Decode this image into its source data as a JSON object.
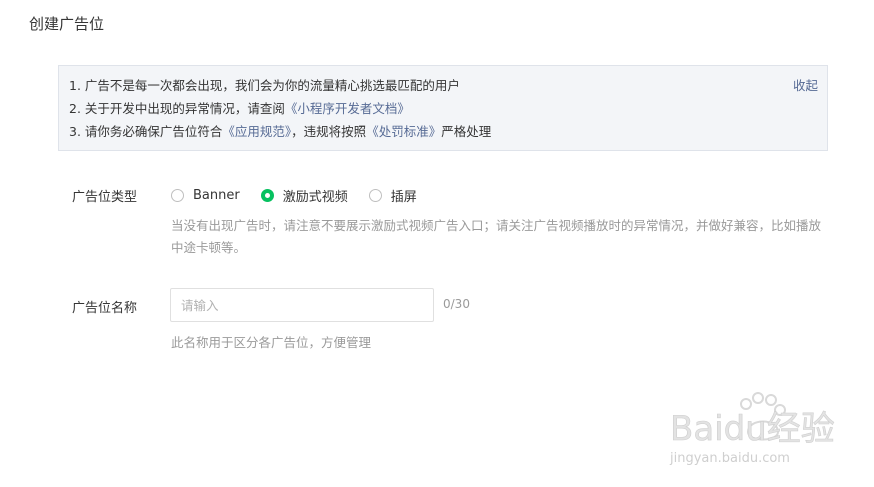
{
  "page": {
    "title": "创建广告位"
  },
  "notice": {
    "line1": "1. 广告不是每一次都会出现，我们会为你的流量精心挑选最匹配的用户",
    "line2_prefix": "2. 关于开发中出现的异常情况，请查阅",
    "line2_link": "《小程序开发者文档》",
    "line3_prefix": "3. 请你务必确保广告位符合",
    "line3_link1": "《应用规范》",
    "line3_mid": "，违规将按照",
    "line3_link2": "《处罚标准》",
    "line3_suffix": "严格处理",
    "collapse_label": "收起"
  },
  "ad_type": {
    "label": "广告位类型",
    "options": [
      {
        "label": "Banner",
        "checked": false
      },
      {
        "label": "激励式视频",
        "checked": true
      },
      {
        "label": "插屏",
        "checked": false
      }
    ],
    "hint": "当没有出现广告时，请注意不要展示激励式视频广告入口；请关注广告视频播放时的异常情况，并做好兼容，比如播放中途卡顿等。"
  },
  "ad_name": {
    "label": "广告位名称",
    "placeholder": "请输入",
    "value": "",
    "counter": "0/30",
    "hint": "此名称用于区分各广告位，方便管理"
  },
  "watermark": {
    "brand": "Baidu经验",
    "url": "jingyan.baidu.com"
  },
  "colors": {
    "accent": "#07c160",
    "link": "#576b95"
  }
}
